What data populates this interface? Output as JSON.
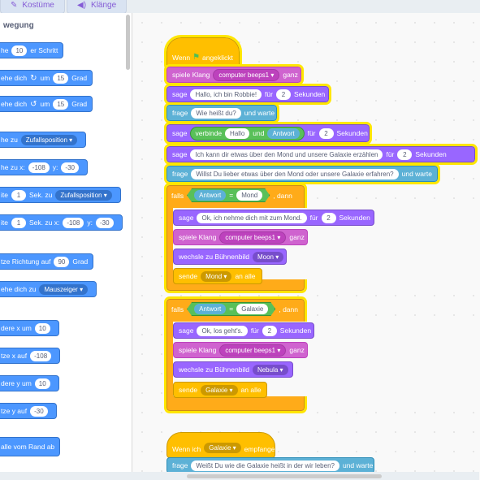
{
  "tabs": [
    {
      "label": "Kostüme",
      "icon": "brush-icon"
    },
    {
      "label": "Klänge",
      "icon": "speaker-icon"
    }
  ],
  "palette": {
    "category": "wegung",
    "blocks": [
      {
        "text": "he",
        "num": "10",
        "after": "er Schritt"
      },
      {
        "text": "ehe dich",
        "arrow": "↻",
        "mid": "um",
        "num": "15",
        "after": "Grad"
      },
      {
        "text": "ehe dich",
        "arrow": "↺",
        "mid": "um",
        "num": "15",
        "after": "Grad"
      },
      {
        "text": "he zu",
        "dd": "Zufallsposition"
      },
      {
        "text": "he zu x:",
        "num": "-108",
        "mid": "y:",
        "num2": "-30"
      },
      {
        "text": "ite",
        "num": "1",
        "mid": "Sek. zu",
        "dd": "Zufallsposition"
      },
      {
        "text": "ite",
        "num": "1",
        "mid": "Sek. zu x:",
        "num2": "-108",
        "mid2": "y:",
        "num3": "-30"
      },
      {
        "text": "tze Richtung auf",
        "num": "90",
        "after": "Grad"
      },
      {
        "text": "ehe dich zu",
        "dd": "Mauszeiger"
      },
      {
        "text": "dere x um",
        "num": "10"
      },
      {
        "text": "tze x auf",
        "num": "-108"
      },
      {
        "text": "dere y um",
        "num": "10"
      },
      {
        "text": "tze y auf",
        "num": "-30"
      },
      {
        "text": "alle vom Rand ab"
      }
    ]
  },
  "script1": {
    "hat": "Wenn",
    "hat_after": "angeklickt",
    "b1": {
      "label": "spiele Klang",
      "dd": "computer beeps1",
      "after": "ganz"
    },
    "b2": {
      "label": "sage",
      "val": "Hallo, ich bin Robbie!",
      "mid": "für",
      "num": "2",
      "after": "Sekunden"
    },
    "b3": {
      "label": "frage",
      "val": "Wie heißt du?",
      "after": "und warte"
    },
    "b4": {
      "label": "sage",
      "op": "verbinde",
      "v1": "Hallo",
      "and": "und",
      "v2": "Antwort",
      "mid": "für",
      "num": "2",
      "after": "Sekunden"
    },
    "b5": {
      "label": "sage",
      "val": "Ich kann dir etwas über den Mond und unsere Galaxie erzählen",
      "mid": "für",
      "num": "2",
      "after": "Sekunden"
    },
    "b6": {
      "label": "frage",
      "val": "Willst Du lieber etwas über den Mond oder unsere Galaxie erfahren?",
      "after": "und warte"
    },
    "if1": {
      "label": "falls",
      "left": "Antwort",
      "eq": "=",
      "right": "Mond",
      "then": ", dann"
    },
    "i1b1": {
      "label": "sage",
      "val": "Ok, ich nehme dich mit zum Mond.",
      "mid": "für",
      "num": "2",
      "after": "Sekunden"
    },
    "i1b2": {
      "label": "spiele Klang",
      "dd": "computer beeps1",
      "after": "ganz"
    },
    "i1b3": {
      "label": "wechsle zu Bühnenbild",
      "dd": "Moon"
    },
    "i1b4": {
      "label": "sende",
      "dd": "Mond",
      "after": "an alle"
    },
    "if2": {
      "label": "falls",
      "left": "Antwort",
      "eq": "=",
      "right": "Galaxie",
      "then": ", dann"
    },
    "i2b1": {
      "label": "sage",
      "val": "Ok, los geht's.",
      "mid": "für",
      "num": "2",
      "after": "Sekunden"
    },
    "i2b2": {
      "label": "spiele Klang",
      "dd": "computer beeps1",
      "after": "ganz"
    },
    "i2b3": {
      "label": "wechsle zu Bühnenbild",
      "dd": "Nebula"
    },
    "i2b4": {
      "label": "sende",
      "dd": "Galaxie",
      "after": "an alle"
    }
  },
  "script2": {
    "hat": "Wenn ich",
    "dd": "Galaxie",
    "hat_after": "empfange",
    "b1": {
      "label": "frage",
      "val": "Weißt Du wie die Galaxie heißt in der wir leben?",
      "after": "und warte"
    }
  }
}
